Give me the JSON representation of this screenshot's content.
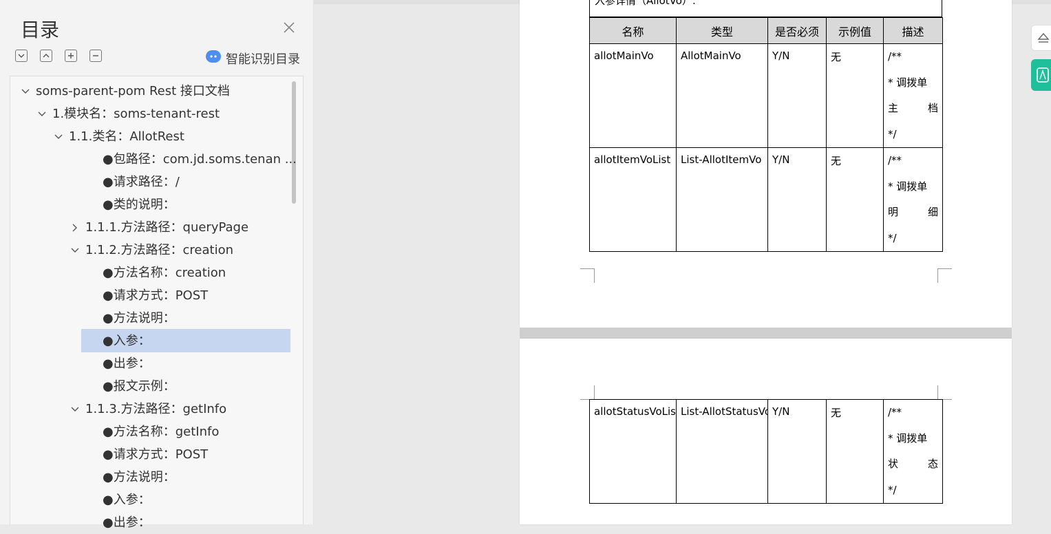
{
  "toc": {
    "title": "目录",
    "smart_label": "智能识别目录",
    "items": [
      {
        "label": "soms-parent-pom Rest 接口文档",
        "expanded": true
      },
      {
        "label": "1.模块名：soms-tenant-rest",
        "expanded": true
      },
      {
        "label": "1.1.类名：AllotRest",
        "expanded": true
      },
      {
        "label": "●包路径：com.jd.soms.tenan ..."
      },
      {
        "label": "●请求路径：/"
      },
      {
        "label": "●类的说明："
      },
      {
        "label": "1.1.1.方法路径：queryPage",
        "expanded": false
      },
      {
        "label": "1.1.2.方法路径：creation",
        "expanded": true
      },
      {
        "label": "●方法名称：creation"
      },
      {
        "label": "●请求方式：POST"
      },
      {
        "label": "●方法说明："
      },
      {
        "label": "●入参：",
        "selected": true
      },
      {
        "label": "●出参："
      },
      {
        "label": "●报文示例："
      },
      {
        "label": "1.1.3.方法路径：getInfo",
        "expanded": true
      },
      {
        "label": "●方法名称：getInfo"
      },
      {
        "label": "●请求方式：POST"
      },
      {
        "label": "●方法说明："
      },
      {
        "label": "●入参："
      },
      {
        "label": "●出参："
      }
    ]
  },
  "document": {
    "cut_heading": "入参详情（AllotVo）:",
    "headers": [
      "名称",
      "类型",
      "是否必须",
      "示例值",
      "描述"
    ],
    "rows": [
      {
        "name": "allotMainVo",
        "type": "AllotMainVo",
        "required": "Y/N",
        "example": "无",
        "desc": [
          "/**",
          "* 调拨单",
          "主档",
          "*/"
        ]
      },
      {
        "name": "allotItemVoList",
        "type": "List-AllotItemVo",
        "required": "Y/N",
        "example": "无",
        "desc": [
          "/**",
          "* 调拨单",
          "明细",
          "*/"
        ]
      }
    ],
    "page2_rows": [
      {
        "name": "allotStatusVoList",
        "type": "List-AllotStatusVo",
        "required": "Y/N",
        "example": "无",
        "desc": [
          "/**",
          "* 调拨单",
          "状态",
          "*/"
        ]
      }
    ]
  }
}
